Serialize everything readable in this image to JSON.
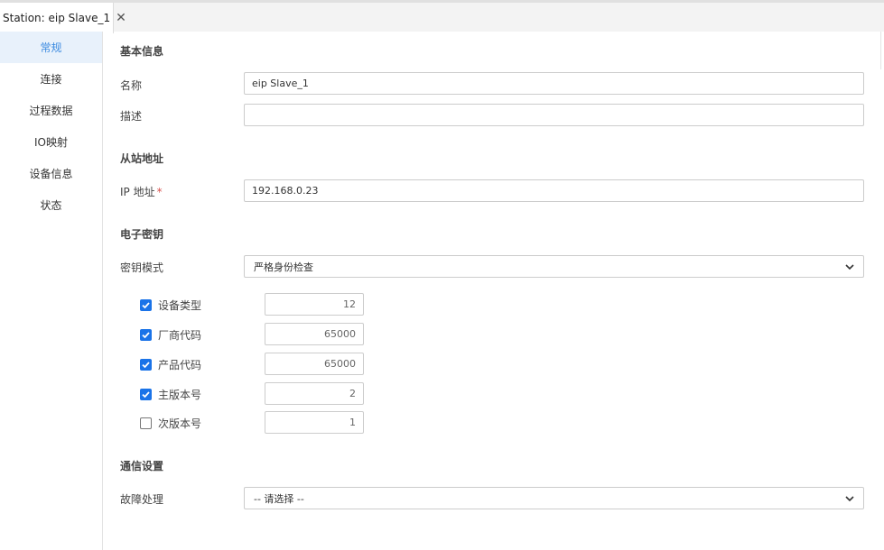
{
  "tab": {
    "title": "Station: eip Slave_1"
  },
  "sidebar": {
    "items": [
      {
        "label": "常规",
        "active": true
      },
      {
        "label": "连接"
      },
      {
        "label": "过程数据"
      },
      {
        "label": "IO映射"
      },
      {
        "label": "设备信息"
      },
      {
        "label": "状态"
      }
    ]
  },
  "basic": {
    "section": "基本信息",
    "name_label": "名称",
    "name_value": "eip Slave_1",
    "desc_label": "描述",
    "desc_value": ""
  },
  "slave": {
    "section": "从站地址",
    "ip_label": "IP 地址",
    "ip_required": "*",
    "ip_value": "192.168.0.23"
  },
  "ekey": {
    "section": "电子密钥",
    "mode_label": "密钥模式",
    "mode_value": "严格身份检查",
    "rows": [
      {
        "label": "设备类型",
        "checked": true,
        "value": "12"
      },
      {
        "label": "厂商代码",
        "checked": true,
        "value": "65000"
      },
      {
        "label": "产品代码",
        "checked": true,
        "value": "65000"
      },
      {
        "label": "主版本号",
        "checked": true,
        "value": "2"
      },
      {
        "label": "次版本号",
        "checked": false,
        "value": "1"
      }
    ]
  },
  "comm": {
    "section": "通信设置",
    "fault_label": "故障处理",
    "fault_value": "-- 请选择 --"
  },
  "colors": {
    "accent": "#3c8be0",
    "checkbox": "#1a73e8",
    "active_bg": "#e8f1fb"
  }
}
